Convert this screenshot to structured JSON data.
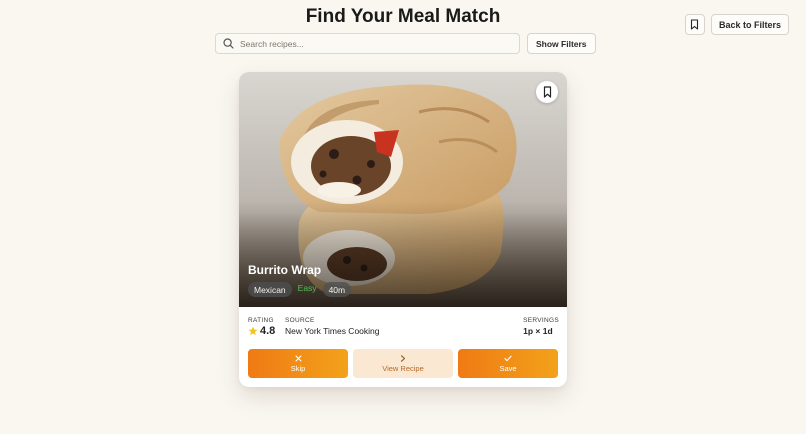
{
  "header": {
    "title": "Find Your Meal Match",
    "back_label": "Back to Filters",
    "bookmark_icon": "bookmark-icon"
  },
  "search": {
    "placeholder": "Search recipes...",
    "value": "",
    "filters_label": "Show Filters"
  },
  "card": {
    "name": "Burrito Wrap",
    "tags": [
      "Mexican",
      "Easy",
      "40m"
    ],
    "rating_label": "RATING",
    "rating_value": "4.8",
    "source_label": "SOURCE",
    "source_value": "New York Times Cooking",
    "servings_label": "SERVINGS",
    "servings_value": "1p × 1d",
    "actions": {
      "skip": "Skip",
      "view": "View Recipe",
      "save": "Save"
    }
  },
  "colors": {
    "background": "#faf7f1",
    "accent_orange": "#f07a14",
    "accent_light": "#fbe8d2",
    "easy_green": "#4fc24f"
  }
}
